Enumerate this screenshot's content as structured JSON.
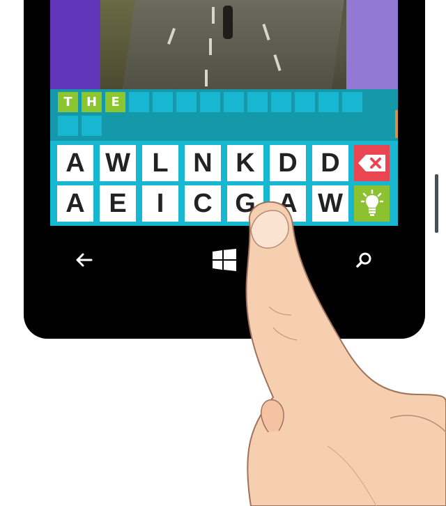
{
  "game": {
    "answer_slots": [
      {
        "letter": "T",
        "filled": true
      },
      {
        "letter": "H",
        "filled": true
      },
      {
        "letter": "E",
        "filled": true
      },
      {
        "letter": "",
        "filled": false
      },
      {
        "letter": "",
        "filled": false
      },
      {
        "letter": "",
        "filled": false
      },
      {
        "letter": "",
        "filled": false
      },
      {
        "letter": "",
        "filled": false
      },
      {
        "letter": "",
        "filled": false
      },
      {
        "letter": "",
        "filled": false
      },
      {
        "letter": "",
        "filled": false
      },
      {
        "letter": "",
        "filled": false
      },
      {
        "letter": "",
        "filled": false
      },
      {
        "letter": "",
        "filled": false
      },
      {
        "letter": "",
        "filled": false
      }
    ],
    "keyboard": {
      "row1": [
        "A",
        "W",
        "L",
        "N",
        "K",
        "D",
        "D"
      ],
      "row2": [
        "A",
        "E",
        "I",
        "C",
        "G",
        "A",
        "W"
      ]
    },
    "actions": {
      "delete": "backspace-icon",
      "hint": "lightbulb-icon"
    }
  },
  "navbar": {
    "back": "back-arrow-icon",
    "home": "windows-logo-icon",
    "search": "search-icon"
  },
  "colors": {
    "answer_bg": "#1598a9",
    "tile_empty": "#17b7d2",
    "tile_filled": "#8bc52f",
    "keyboard_bg": "#17b7d2",
    "delete_key": "#ea4651",
    "hint_key": "#8cc22f"
  }
}
